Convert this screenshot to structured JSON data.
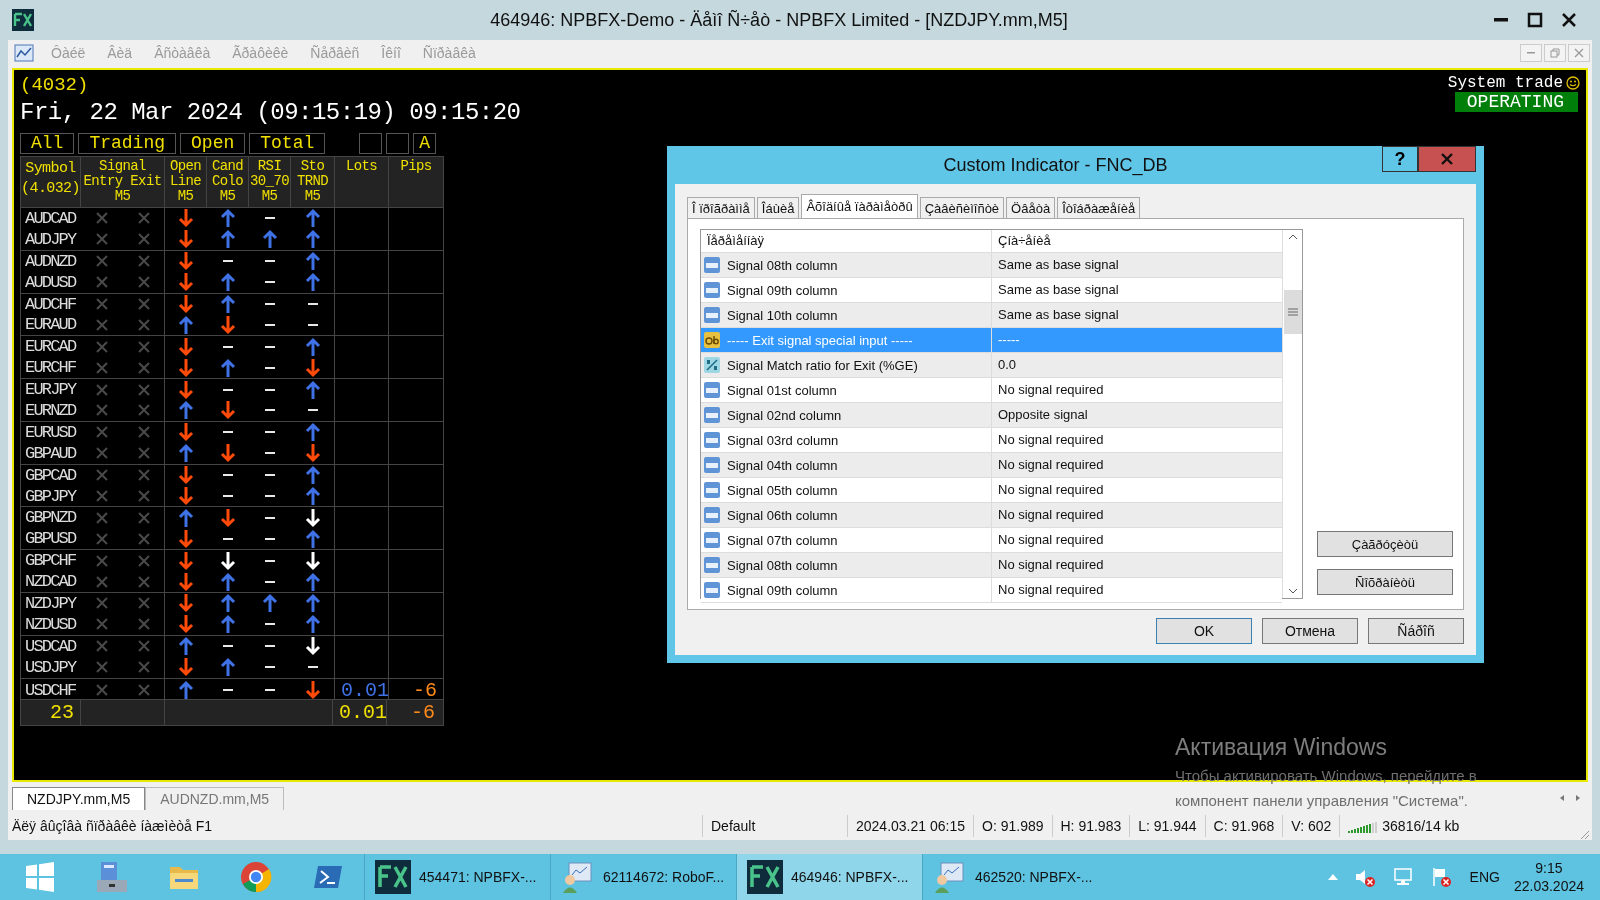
{
  "window": {
    "title": "464946: NPBFX-Demo - Äåìî Ñ÷åò - NPBFX Limited - [NZDJPY.mm,M5]"
  },
  "menu": [
    "Ôàéë",
    "Âèä",
    "Âñòàâêà",
    "Ãðàôèêè",
    "Ñåðâèñ",
    "Îêíî",
    "Ñïðàâêà"
  ],
  "chart": {
    "counter": "(4032)",
    "datetime": "Fri, 22 Mar 2024 (09:15:19) 09:15:20",
    "filters": [
      "All",
      "Trading",
      "Open",
      "Total"
    ],
    "mode_button": "A",
    "system_label": "System trade",
    "status": {
      "label": "OPERATING",
      "active": true
    },
    "columns": [
      "Symbol\n(4.032)",
      "Signal\nEntry Exit\nM5",
      "Open\nLine\nM5",
      "Cand\nColo\nM5",
      "RSI\n30_70\nM5",
      "Sto\nTRND\nM5",
      "Lots",
      "Pips"
    ],
    "rows": [
      {
        "symbol": "AUDCAD",
        "entry": false,
        "exit": false,
        "signals": [
          {
            "kind": "down"
          },
          {
            "kind": "up"
          },
          {
            "kind": "flat"
          },
          {
            "kind": "up"
          }
        ]
      },
      {
        "symbol": "AUDJPY",
        "entry": false,
        "exit": false,
        "signals": [
          {
            "kind": "down"
          },
          {
            "kind": "up"
          },
          {
            "kind": "up"
          },
          {
            "kind": "up"
          }
        ]
      },
      {
        "symbol": "AUDNZD",
        "entry": false,
        "exit": false,
        "signals": [
          {
            "kind": "down"
          },
          {
            "kind": "flat"
          },
          {
            "kind": "flat"
          },
          {
            "kind": "up"
          }
        ]
      },
      {
        "symbol": "AUDUSD",
        "entry": false,
        "exit": false,
        "signals": [
          {
            "kind": "down"
          },
          {
            "kind": "up"
          },
          {
            "kind": "flat"
          },
          {
            "kind": "up"
          }
        ]
      },
      {
        "symbol": "AUDCHF",
        "entry": false,
        "exit": false,
        "signals": [
          {
            "kind": "down"
          },
          {
            "kind": "up"
          },
          {
            "kind": "flat"
          },
          {
            "kind": "flat"
          }
        ]
      },
      {
        "symbol": "EURAUD",
        "entry": false,
        "exit": false,
        "signals": [
          {
            "kind": "up"
          },
          {
            "kind": "down"
          },
          {
            "kind": "flat"
          },
          {
            "kind": "flat"
          }
        ]
      },
      {
        "symbol": "EURCAD",
        "entry": false,
        "exit": false,
        "signals": [
          {
            "kind": "down"
          },
          {
            "kind": "flat"
          },
          {
            "kind": "flat"
          },
          {
            "kind": "up"
          }
        ]
      },
      {
        "symbol": "EURCHF",
        "entry": false,
        "exit": false,
        "signals": [
          {
            "kind": "down"
          },
          {
            "kind": "up"
          },
          {
            "kind": "flat"
          },
          {
            "kind": "down"
          }
        ]
      },
      {
        "symbol": "EURJPY",
        "entry": false,
        "exit": false,
        "signals": [
          {
            "kind": "down"
          },
          {
            "kind": "flat"
          },
          {
            "kind": "flat"
          },
          {
            "kind": "up"
          }
        ]
      },
      {
        "symbol": "EURNZD",
        "entry": false,
        "exit": false,
        "signals": [
          {
            "kind": "up"
          },
          {
            "kind": "down"
          },
          {
            "kind": "flat"
          },
          {
            "kind": "flat"
          }
        ]
      },
      {
        "symbol": "EURUSD",
        "entry": false,
        "exit": false,
        "signals": [
          {
            "kind": "down"
          },
          {
            "kind": "flat"
          },
          {
            "kind": "flat"
          },
          {
            "kind": "up"
          }
        ]
      },
      {
        "symbol": "GBPAUD",
        "entry": false,
        "exit": false,
        "signals": [
          {
            "kind": "up"
          },
          {
            "kind": "down"
          },
          {
            "kind": "flat"
          },
          {
            "kind": "down"
          }
        ]
      },
      {
        "symbol": "GBPCAD",
        "entry": false,
        "exit": false,
        "signals": [
          {
            "kind": "down"
          },
          {
            "kind": "flat"
          },
          {
            "kind": "flat"
          },
          {
            "kind": "up"
          }
        ]
      },
      {
        "symbol": "GBPJPY",
        "entry": false,
        "exit": false,
        "signals": [
          {
            "kind": "down"
          },
          {
            "kind": "flat"
          },
          {
            "kind": "flat"
          },
          {
            "kind": "up"
          }
        ]
      },
      {
        "symbol": "GBPNZD",
        "entry": false,
        "exit": false,
        "signals": [
          {
            "kind": "up"
          },
          {
            "kind": "down"
          },
          {
            "kind": "flat"
          },
          {
            "kind": "strong_down"
          }
        ]
      },
      {
        "symbol": "GBPUSD",
        "entry": false,
        "exit": false,
        "signals": [
          {
            "kind": "down"
          },
          {
            "kind": "flat"
          },
          {
            "kind": "flat"
          },
          {
            "kind": "up"
          }
        ]
      },
      {
        "symbol": "GBPCHF",
        "entry": false,
        "exit": false,
        "signals": [
          {
            "kind": "down"
          },
          {
            "kind": "strong_down"
          },
          {
            "kind": "flat"
          },
          {
            "kind": "strong_down"
          }
        ]
      },
      {
        "symbol": "NZDCAD",
        "entry": false,
        "exit": false,
        "signals": [
          {
            "kind": "down"
          },
          {
            "kind": "up"
          },
          {
            "kind": "flat"
          },
          {
            "kind": "up"
          }
        ]
      },
      {
        "symbol": "NZDJPY",
        "entry": false,
        "exit": false,
        "signals": [
          {
            "kind": "down"
          },
          {
            "kind": "up"
          },
          {
            "kind": "up"
          },
          {
            "kind": "up"
          }
        ]
      },
      {
        "symbol": "NZDUSD",
        "entry": false,
        "exit": false,
        "signals": [
          {
            "kind": "down"
          },
          {
            "kind": "up"
          },
          {
            "kind": "flat"
          },
          {
            "kind": "up"
          }
        ]
      },
      {
        "symbol": "USDCAD",
        "entry": false,
        "exit": false,
        "signals": [
          {
            "kind": "up"
          },
          {
            "kind": "flat"
          },
          {
            "kind": "flat"
          },
          {
            "kind": "strong_down"
          }
        ]
      },
      {
        "symbol": "USDJPY",
        "entry": false,
        "exit": false,
        "signals": [
          {
            "kind": "down"
          },
          {
            "kind": "up"
          },
          {
            "kind": "flat"
          },
          {
            "kind": "flat"
          }
        ]
      },
      {
        "symbol": "USDCHF",
        "entry": false,
        "exit": false,
        "signals": [
          {
            "kind": "up"
          },
          {
            "kind": "flat"
          },
          {
            "kind": "flat"
          },
          {
            "kind": "down"
          }
        ],
        "lots": "0.01",
        "pips": "-6"
      }
    ],
    "footer": {
      "count": "23",
      "lots": "0.01",
      "pips": "-6"
    }
  },
  "dialog": {
    "title": "Custom Indicator - FNC_DB",
    "help": "?",
    "tabs": [
      {
        "label": "Î ïðîãðàììå",
        "selected": false
      },
      {
        "label": "Îáùèå",
        "selected": false
      },
      {
        "label": "Âõîäíûå ïàðàìåòðû",
        "selected": true
      },
      {
        "label": "Çàâèñèìîñòè",
        "selected": false
      },
      {
        "label": "Öâåòà",
        "selected": false
      },
      {
        "label": "Îòîáðàæåíèå",
        "selected": false
      }
    ],
    "table_columns": [
      "Ïåðåìåííàÿ",
      "Çíà÷åíèå"
    ],
    "rows": [
      {
        "kind": "int",
        "name": "Signal 08th column",
        "value": "Same as base signal",
        "selected": false
      },
      {
        "kind": "int",
        "name": "Signal 09th column",
        "value": "Same as base signal",
        "selected": false
      },
      {
        "kind": "int",
        "name": "Signal 10th column",
        "value": "Same as base signal",
        "selected": false
      },
      {
        "kind": "string",
        "name": "----- Exit signal special input -----",
        "value": "-----",
        "selected": true
      },
      {
        "kind": "double",
        "name": "Signal Match ratio for Exit (%GE)",
        "value": "0.0",
        "selected": false
      },
      {
        "kind": "int",
        "name": "Signal 01st column",
        "value": "No signal required",
        "selected": false
      },
      {
        "kind": "int",
        "name": "Signal 02nd column",
        "value": "Opposite signal",
        "selected": false
      },
      {
        "kind": "int",
        "name": "Signal 03rd column",
        "value": "No signal required",
        "selected": false
      },
      {
        "kind": "int",
        "name": "Signal 04th column",
        "value": "No signal required",
        "selected": false
      },
      {
        "kind": "int",
        "name": "Signal 05th column",
        "value": "No signal required",
        "selected": false
      },
      {
        "kind": "int",
        "name": "Signal 06th column",
        "value": "No signal required",
        "selected": false
      },
      {
        "kind": "int",
        "name": "Signal 07th column",
        "value": "No signal required",
        "selected": false
      },
      {
        "kind": "int",
        "name": "Signal 08th column",
        "value": "No signal required",
        "selected": false
      },
      {
        "kind": "int",
        "name": "Signal 09th column",
        "value": "No signal required",
        "selected": false
      }
    ],
    "side_buttons": [
      "Çàãðóçèòü",
      "Ñîõðàíèòü"
    ],
    "buttons": [
      "OK",
      "Отмена",
      "Ñáðîñ"
    ]
  },
  "activation_notice": {
    "title": "Активация Windows",
    "text": "Чтобы активировать Windows, перейдите в компонент панели управления \"Система\"."
  },
  "chart_tabs": [
    {
      "label": "NZDJPY.mm,M5",
      "selected": true
    },
    {
      "label": "AUDNZD.mm,M5",
      "selected": false
    }
  ],
  "status_bar": {
    "help": "Äëÿ âûçîâà ñïðàâêè íàæìèòå F1",
    "fields": [
      "Default",
      "2024.03.21 06:15",
      "O: 91.989",
      "H: 91.983",
      "L: 91.944",
      "C: 91.968",
      "V: 602"
    ],
    "traffic": "36816/14 kb"
  },
  "taskbar": {
    "tasks": [
      {
        "kind": "fx",
        "label": "454471: NPBFX-...",
        "selected": false
      },
      {
        "kind": "robot",
        "label": "62114672: RoboF...",
        "selected": false
      },
      {
        "kind": "fx",
        "label": "464946: NPBFX-...",
        "selected": true
      },
      {
        "kind": "robot",
        "label": "462520: NPBFX-...",
        "selected": false
      }
    ],
    "language": "ENG",
    "time": "9:15",
    "date": "22.03.2024"
  }
}
